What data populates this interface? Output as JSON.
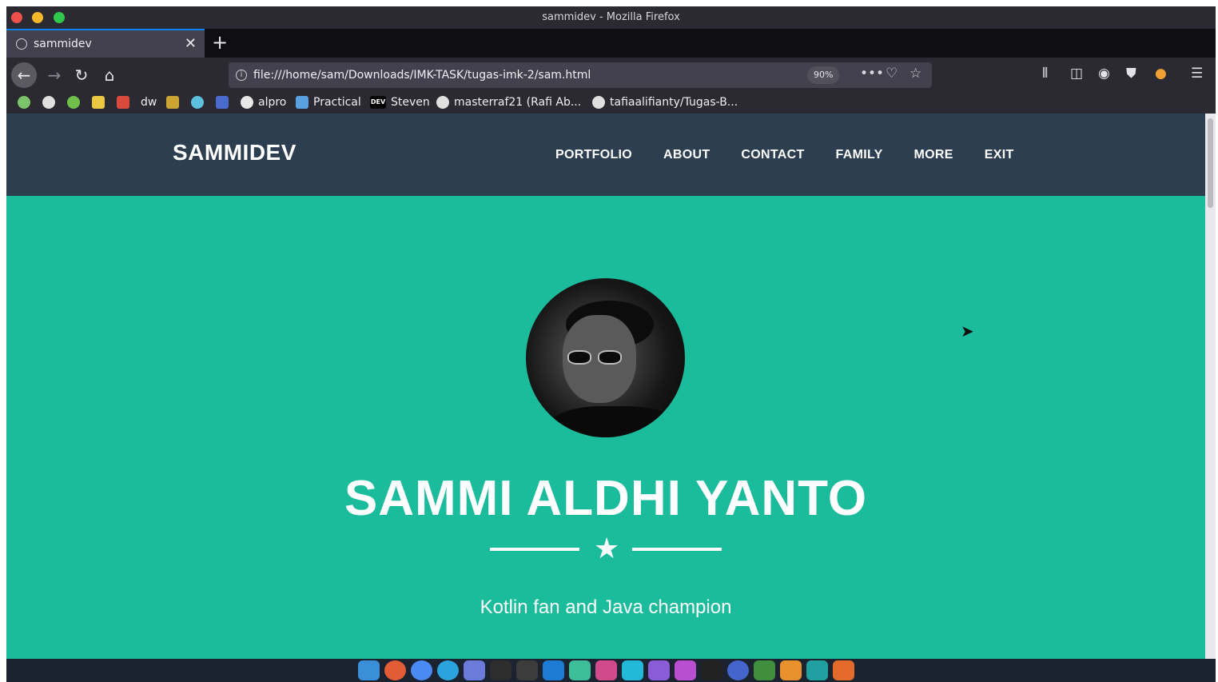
{
  "window": {
    "title": "sammidev - Mozilla Firefox"
  },
  "tab": {
    "title": "sammidev",
    "close": "✕",
    "new_tab": "+"
  },
  "toolbar": {
    "url": "file:///home/sam/Downloads/IMK-TASK/tugas-imk-2/sam.html",
    "zoom": "90%",
    "icons": [
      "back-icon",
      "forward-icon",
      "reload-icon",
      "home-icon",
      "page-actions-icon",
      "pocket-icon",
      "bookmark-star-icon",
      "library-icon",
      "sidebar-icon",
      "account-icon",
      "shield-icon",
      "extension-icon",
      "menu-icon"
    ]
  },
  "bookmarks": {
    "items": [
      {
        "label": "alpro",
        "icon": "github-icon"
      },
      {
        "label": "Practical",
        "icon": "feather-icon"
      },
      {
        "label": "Steven",
        "icon": "dev-icon"
      },
      {
        "label": "masterraf21 (Rafi Ab...",
        "icon": "github-icon"
      },
      {
        "label": "tafiaalifianty/Tugas-B...",
        "icon": "github-icon"
      }
    ],
    "dw_label": "dw",
    "dev_badge": "DEV"
  },
  "site": {
    "brand": "SAMMIDEV",
    "menu": [
      "PORTFOLIO",
      "ABOUT",
      "CONTACT",
      "FAMILY",
      "MORE",
      "EXIT"
    ],
    "hero_name": "SAMMI ALDHI YANTO",
    "tagline": "Kotlin fan and Java champion",
    "star": "★"
  },
  "colors": {
    "hero_bg": "#1abc9c",
    "nav_bg": "#2c3e50",
    "browser_chrome": "#2b2a33"
  }
}
